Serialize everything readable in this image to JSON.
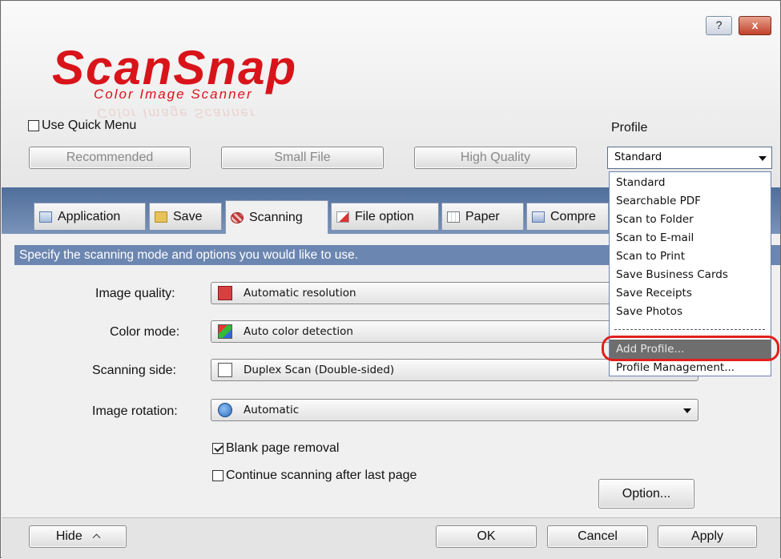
{
  "titlebar": {
    "help_label": "?",
    "close_label": "x"
  },
  "logo": {
    "brand": "ScanSnap",
    "subtitle": "Color Image Scanner"
  },
  "quick_menu": {
    "label": "Use Quick Menu",
    "checked": false
  },
  "presets": {
    "recommended": "Recommended",
    "small_file": "Small File",
    "high_quality": "High Quality"
  },
  "profile": {
    "label": "Profile",
    "selected": "Standard",
    "options": [
      "Standard",
      "Searchable PDF",
      "Scan to Folder",
      "Scan to E-mail",
      "Scan to Print",
      "Save Business Cards",
      "Save Receipts",
      "Save Photos"
    ],
    "add_profile": "Add Profile...",
    "profile_management": "Profile Management..."
  },
  "tabs": [
    {
      "label": "Application",
      "icon": "application-icon"
    },
    {
      "label": "Save",
      "icon": "folder-icon"
    },
    {
      "label": "Scanning",
      "icon": "scanning-icon"
    },
    {
      "label": "File option",
      "icon": "file-option-icon"
    },
    {
      "label": "Paper",
      "icon": "paper-icon"
    },
    {
      "label": "Compre",
      "icon": "compression-icon"
    }
  ],
  "banner": "Specify the scanning mode and options you would like to use.",
  "settings": {
    "image_quality": {
      "label": "Image quality:",
      "value": "Automatic resolution"
    },
    "color_mode": {
      "label": "Color mode:",
      "value": "Auto color detection"
    },
    "scanning_side": {
      "label": "Scanning side:",
      "value": "Duplex Scan (Double-sided)"
    },
    "image_rotation": {
      "label": "Image rotation:",
      "value": "Automatic"
    }
  },
  "options": {
    "blank_page": {
      "label": "Blank page removal",
      "checked": true
    },
    "continue": {
      "label": "Continue scanning after last page",
      "checked": false
    },
    "option_button": "Option..."
  },
  "footer": {
    "hide": "Hide",
    "ok": "OK",
    "cancel": "Cancel",
    "apply": "Apply"
  },
  "colors": {
    "brand_red": "#d8141a",
    "tab_strip": "#5a78a6",
    "banner": "#6b86b0",
    "highlight_ring": "#e0201e"
  }
}
